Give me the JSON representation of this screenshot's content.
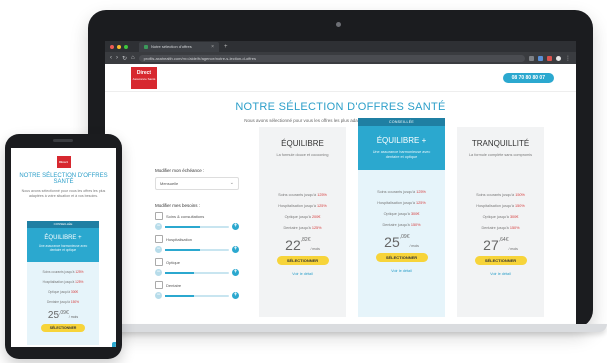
{
  "browser": {
    "tab_title": "Notre sélection d'offres",
    "url": "profils.axahealth.com/m=/aide/fr/agence/notre-s-lection-d-offres"
  },
  "site": {
    "logo_line1": "Direct",
    "logo_line2": "Assurance Santé",
    "phone": "08 70 80 80 07",
    "title": "NOTRE SÉLECTION D'OFFRES SANTÉ",
    "subtitle": "Nous avons sélectionné pour vous les offres les plus adaptées à votre situation et à vos besoins."
  },
  "sidebar": {
    "due_label": "Modifier mon échéance :",
    "due_value": "Mensuelle",
    "needs_label": "Modifier mes besoins :",
    "needs": [
      {
        "label": "Soins & consultations",
        "level": 0.55
      },
      {
        "label": "Hospitalisation",
        "level": 0.55
      },
      {
        "label": "Optique",
        "level": 0.45
      },
      {
        "label": "Dentaire",
        "level": 0.45
      }
    ]
  },
  "offers": [
    {
      "name": "ÉQUILIBRE",
      "desc": "La formule douce et cocooning",
      "rows": [
        {
          "label": "Soins courants jusqu'à",
          "value": "125%"
        },
        {
          "label": "Hospitalisation jusqu'à",
          "value": "125%"
        },
        {
          "label": "Optique jusqu'à",
          "value": "200€"
        },
        {
          "label": "Dentaire jusqu'à",
          "value": "125%"
        }
      ],
      "price_int": "22",
      "price_dec": ",82€",
      "per": "/ mois",
      "cta": "SÉLECTIONNER",
      "detail": "Voir le détail"
    },
    {
      "badge": "CONSEILLÉE",
      "name": "ÉQUILIBRE +",
      "desc": "Une assurance harmonieuse avec dentaire et optique",
      "rows": [
        {
          "label": "Soins courants jusqu'à",
          "value": "125%"
        },
        {
          "label": "Hospitalisation jusqu'à",
          "value": "125%"
        },
        {
          "label": "Optique jusqu'à",
          "value": "300€"
        },
        {
          "label": "Dentaire jusqu'à",
          "value": "150%"
        }
      ],
      "price_int": "25",
      "price_dec": ",09€",
      "per": "/ mois",
      "cta": "SÉLECTIONNER",
      "detail": "Voir le détail"
    },
    {
      "name": "TRANQUILLITÉ",
      "desc": "La formule complète sans compromis",
      "rows": [
        {
          "label": "Soins courants jusqu'à",
          "value": "150%"
        },
        {
          "label": "Hospitalisation jusqu'à",
          "value": "150%"
        },
        {
          "label": "Optique jusqu'à",
          "value": "300€"
        },
        {
          "label": "Dentaire jusqu'à",
          "value": "150%"
        }
      ],
      "price_int": "27",
      "price_dec": ",64€",
      "per": "/ mois",
      "cta": "SÉLECTIONNER",
      "detail": "Voir le détail"
    }
  ],
  "mobile": {
    "title": "NOTRE SÉLECTION D'OFFRES SANTÉ",
    "subtitle": "Nous avons sélectionné pour vous les offres les plus adaptées à votre situation et à vos besoins.",
    "badge": "CONSEILLÉE",
    "name": "ÉQUILIBRE +",
    "desc": "Une assurance harmonieuse avec dentaire et optique",
    "rows": [
      {
        "label": "Soins courants jusqu'à",
        "value": "125%"
      },
      {
        "label": "Hospitalisation jusqu'à",
        "value": "125%"
      },
      {
        "label": "Optique jusqu'à",
        "value": "300€"
      },
      {
        "label": "Dentaire jusqu'à",
        "value": "150%"
      }
    ],
    "price_int": "25",
    "price_dec": ",09€",
    "per": "/ mois",
    "cta": "SÉLECTIONNER"
  },
  "colors": {
    "accent": "#2ba8cf",
    "brand_red": "#d7282f",
    "cta_yellow": "#f7d43a"
  }
}
